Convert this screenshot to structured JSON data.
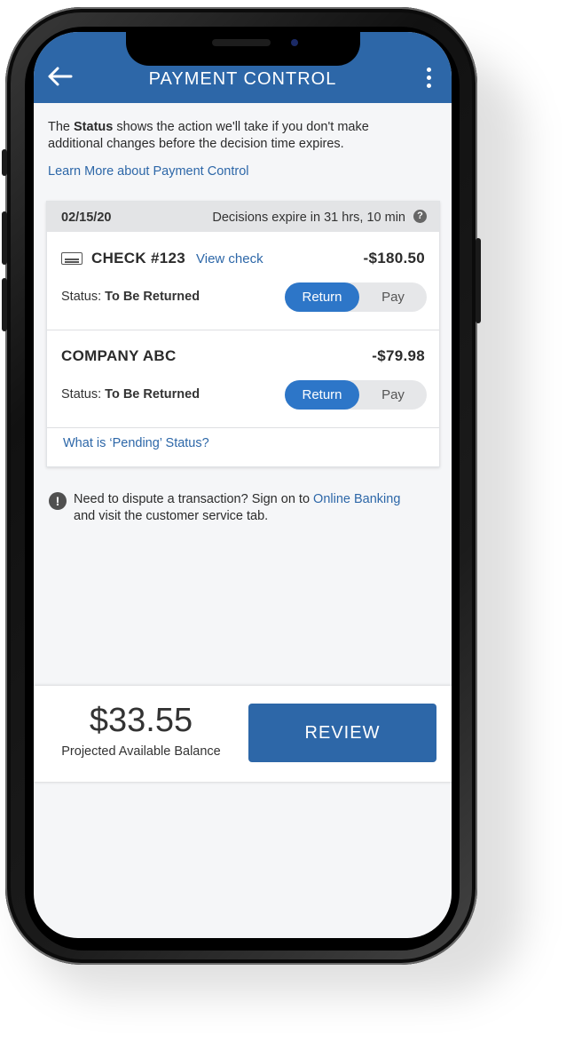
{
  "header": {
    "title": "PAYMENT CONTROL",
    "back_icon": "arrow-left-icon",
    "menu_icon": "vertical-dots-icon",
    "color": "#2d67a8"
  },
  "intro": {
    "text_before": "The ",
    "bold": "Status",
    "text_after": " shows the action we'll take if you don't make additional changes before the decision time expires.",
    "learn_link": "Learn More about Payment Control"
  },
  "card": {
    "date": "02/15/20",
    "expire": "Decisions expire in 31 hrs, 10 min",
    "help_icon": "?",
    "transactions": [
      {
        "payee": "CHECK #123",
        "view_link": "View check",
        "amount": "-$180.50",
        "status_label": "Status:",
        "status_value": "To Be Returned",
        "option_return": "Return",
        "option_pay": "Pay",
        "selected": "Return"
      },
      {
        "payee": "COMPANY ABC",
        "amount": "-$79.98",
        "status_label": "Status:",
        "status_value": "To Be Returned",
        "option_return": "Return",
        "option_pay": "Pay",
        "selected": "Return"
      }
    ],
    "pending_link": "What is ‘Pending’ Status?"
  },
  "notice": {
    "icon": "!",
    "text_before": "Need to dispute a transaction? Sign on to ",
    "link": "Online Banking",
    "text_after": " and visit the customer service tab."
  },
  "footer": {
    "balance": "$33.55",
    "balance_label": "Projected Available Balance",
    "review_button": "REVIEW"
  }
}
